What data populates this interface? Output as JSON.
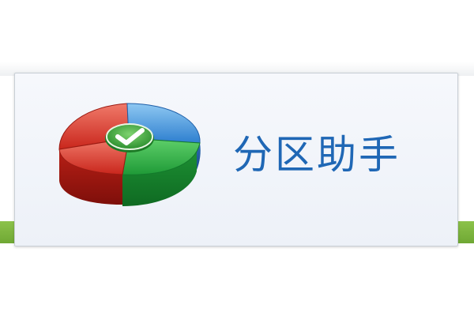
{
  "app": {
    "name": "分区助手",
    "logo_icon": "partition-pie-checkmark-icon"
  },
  "colors": {
    "title_blue": "#1f67b5",
    "pie_red": "#d63a2c",
    "pie_blue": "#3a8fd8",
    "pie_green": "#2fa84a",
    "check_badge": "#3aa33f",
    "accent_green": "#7db63f"
  }
}
